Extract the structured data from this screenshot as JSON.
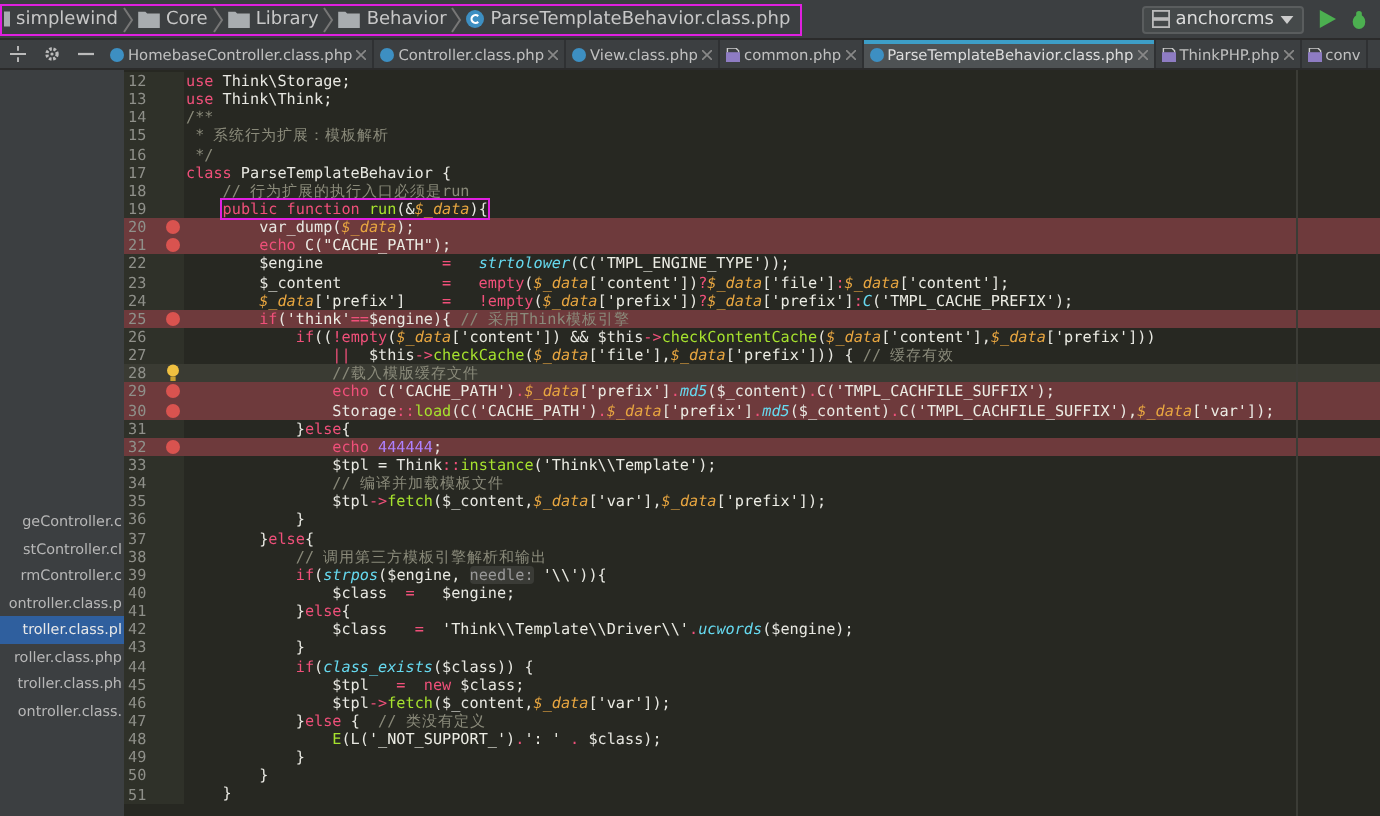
{
  "breadcrumb": {
    "annotated": true,
    "items": [
      {
        "kind": "module",
        "label": "simplewind"
      },
      {
        "kind": "folder",
        "label": "Core"
      },
      {
        "kind": "folder",
        "label": "Library"
      },
      {
        "kind": "folder",
        "label": "Behavior"
      },
      {
        "kind": "class",
        "label": "ParseTemplateBehavior.class.php"
      }
    ]
  },
  "run_config": {
    "label": "anchorcms"
  },
  "tabs": [
    {
      "label": "HomebaseController.class.php",
      "kind": "class",
      "selected": false
    },
    {
      "label": "Controller.class.php",
      "kind": "class",
      "selected": false
    },
    {
      "label": "View.class.php",
      "kind": "class",
      "selected": false
    },
    {
      "label": "common.php",
      "kind": "php",
      "selected": false
    },
    {
      "label": "ParseTemplateBehavior.class.php",
      "kind": "class",
      "selected": true
    },
    {
      "label": "ThinkPHP.php",
      "kind": "php",
      "selected": false
    },
    {
      "label": "conv",
      "kind": "php",
      "selected": false
    }
  ],
  "project_files": [
    {
      "label": "geController.c",
      "selected": false
    },
    {
      "label": "stController.cl",
      "selected": false
    },
    {
      "label": "rmController.c",
      "selected": false
    },
    {
      "label": "ontroller.class.p",
      "selected": false
    },
    {
      "label": "troller.class.pl",
      "selected": true
    },
    {
      "label": "roller.class.php",
      "selected": false
    },
    {
      "label": "troller.class.ph",
      "selected": false
    },
    {
      "label": "ontroller.class.",
      "selected": false
    }
  ],
  "lines": [
    {
      "n": "12",
      "tokens": [
        {
          "kind": "kw",
          "text": "use"
        },
        {
          "kind": "plain",
          "text": " Think\\Storage;"
        }
      ]
    },
    {
      "n": "13",
      "tokens": [
        {
          "kind": "kw",
          "text": "use"
        },
        {
          "kind": "plain",
          "text": " Think\\Think;"
        }
      ]
    },
    {
      "n": "14",
      "tokens": [
        {
          "kind": "comment",
          "text": "/**"
        }
      ]
    },
    {
      "n": "15",
      "tokens": [
        {
          "kind": "comment",
          "text": " * 系统行为扩展：模板解析"
        }
      ]
    },
    {
      "n": "16",
      "tokens": [
        {
          "kind": "comment",
          "text": " */"
        }
      ]
    },
    {
      "n": "17",
      "tokens": [
        {
          "kind": "kw",
          "text": "class"
        },
        {
          "kind": "plain",
          "text": " ParseTemplateBehavior {"
        }
      ]
    },
    {
      "n": "18",
      "tokens": [
        {
          "kind": "comment",
          "text": "    // 行为扩展的执行入口必须是run"
        }
      ]
    },
    {
      "n": "19",
      "annotated": true,
      "tokens": [
        {
          "kind": "kw",
          "text": "    public function "
        },
        {
          "kind": "fn",
          "text": "run"
        },
        {
          "kind": "plain",
          "text": "(&"
        },
        {
          "kind": "var",
          "text": "$_data"
        },
        {
          "kind": "plain",
          "text": "){"
        }
      ]
    },
    {
      "n": "20",
      "breakpoint": true,
      "tokens": [
        {
          "kind": "plain",
          "text": "        var_dump("
        },
        {
          "kind": "var",
          "text": "$_data"
        },
        {
          "kind": "plain",
          "text": ");"
        }
      ]
    },
    {
      "n": "21",
      "breakpoint": true,
      "tokens": [
        {
          "kind": "kw",
          "text": "        echo"
        },
        {
          "kind": "plain",
          "text": " C("
        },
        {
          "kind": "str",
          "text": "\"CACHE_PATH\""
        },
        {
          "kind": "plain",
          "text": ");"
        }
      ]
    },
    {
      "n": "22",
      "tokens": [
        {
          "kind": "plain",
          "text": "        $engine             "
        },
        {
          "kind": "kw",
          "text": "=   "
        },
        {
          "kind": "ifn",
          "text": "strtolower"
        },
        {
          "kind": "plain",
          "text": "(C("
        },
        {
          "kind": "str",
          "text": "'TMPL_ENGINE_TYPE'"
        },
        {
          "kind": "plain",
          "text": "));"
        }
      ]
    },
    {
      "n": "23",
      "tokens": [
        {
          "kind": "plain",
          "text": "        $_content           "
        },
        {
          "kind": "kw",
          "text": "=   empty"
        },
        {
          "kind": "plain",
          "text": "("
        },
        {
          "kind": "var",
          "text": "$_data"
        },
        {
          "kind": "plain",
          "text": "["
        },
        {
          "kind": "str",
          "text": "'content'"
        },
        {
          "kind": "plain",
          "text": "])"
        },
        {
          "kind": "kw",
          "text": "?"
        },
        {
          "kind": "var",
          "text": "$_data"
        },
        {
          "kind": "plain",
          "text": "["
        },
        {
          "kind": "str",
          "text": "'file'"
        },
        {
          "kind": "plain",
          "text": "]"
        },
        {
          "kind": "kw",
          "text": ":"
        },
        {
          "kind": "var",
          "text": "$_data"
        },
        {
          "kind": "plain",
          "text": "["
        },
        {
          "kind": "str",
          "text": "'content'"
        },
        {
          "kind": "plain",
          "text": "];"
        }
      ]
    },
    {
      "n": "24",
      "tokens": [
        {
          "kind": "var",
          "text": "        $_data"
        },
        {
          "kind": "plain",
          "text": "["
        },
        {
          "kind": "str",
          "text": "'prefix'"
        },
        {
          "kind": "plain",
          "text": "]    "
        },
        {
          "kind": "kw",
          "text": "=   !empty"
        },
        {
          "kind": "plain",
          "text": "("
        },
        {
          "kind": "var",
          "text": "$_data"
        },
        {
          "kind": "plain",
          "text": "["
        },
        {
          "kind": "str",
          "text": "'prefix'"
        },
        {
          "kind": "plain",
          "text": "])"
        },
        {
          "kind": "kw",
          "text": "?"
        },
        {
          "kind": "var",
          "text": "$_data"
        },
        {
          "kind": "plain",
          "text": "["
        },
        {
          "kind": "str",
          "text": "'prefix'"
        },
        {
          "kind": "plain",
          "text": "]"
        },
        {
          "kind": "kw",
          "text": ":"
        },
        {
          "kind": "ifn",
          "text": "C"
        },
        {
          "kind": "plain",
          "text": "("
        },
        {
          "kind": "str",
          "text": "'TMPL_CACHE_PREFIX'"
        },
        {
          "kind": "plain",
          "text": ");"
        }
      ]
    },
    {
      "n": "25",
      "breakpoint": true,
      "tokens": [
        {
          "kind": "kw",
          "text": "        if"
        },
        {
          "kind": "plain",
          "text": "("
        },
        {
          "kind": "str",
          "text": "'think'"
        },
        {
          "kind": "kw",
          "text": "=="
        },
        {
          "kind": "plain",
          "text": "$engine){ "
        },
        {
          "kind": "comment",
          "text": "// 采用Think模板引擎"
        }
      ]
    },
    {
      "n": "26",
      "tokens": [
        {
          "kind": "kw",
          "text": "            if"
        },
        {
          "kind": "plain",
          "text": "(("
        },
        {
          "kind": "kw",
          "text": "!empty"
        },
        {
          "kind": "plain",
          "text": "("
        },
        {
          "kind": "var",
          "text": "$_data"
        },
        {
          "kind": "plain",
          "text": "["
        },
        {
          "kind": "str",
          "text": "'content'"
        },
        {
          "kind": "plain",
          "text": "]) && $this"
        },
        {
          "kind": "kw",
          "text": "->"
        },
        {
          "kind": "fn",
          "text": "checkContentCache"
        },
        {
          "kind": "plain",
          "text": "("
        },
        {
          "kind": "var",
          "text": "$_data"
        },
        {
          "kind": "plain",
          "text": "["
        },
        {
          "kind": "str",
          "text": "'content'"
        },
        {
          "kind": "plain",
          "text": "],"
        },
        {
          "kind": "var",
          "text": "$_data"
        },
        {
          "kind": "plain",
          "text": "["
        },
        {
          "kind": "str",
          "text": "'prefix'"
        },
        {
          "kind": "plain",
          "text": "]))"
        }
      ]
    },
    {
      "n": "27",
      "tokens": [
        {
          "kind": "kw",
          "text": "                ||"
        },
        {
          "kind": "plain",
          "text": "  $this"
        },
        {
          "kind": "kw",
          "text": "->"
        },
        {
          "kind": "fn",
          "text": "checkCache"
        },
        {
          "kind": "plain",
          "text": "("
        },
        {
          "kind": "var",
          "text": "$_data"
        },
        {
          "kind": "plain",
          "text": "["
        },
        {
          "kind": "str",
          "text": "'file'"
        },
        {
          "kind": "plain",
          "text": "],"
        },
        {
          "kind": "var",
          "text": "$_data"
        },
        {
          "kind": "plain",
          "text": "["
        },
        {
          "kind": "str",
          "text": "'prefix'"
        },
        {
          "kind": "plain",
          "text": "])) { "
        },
        {
          "kind": "comment",
          "text": "// 缓存有效"
        }
      ]
    },
    {
      "n": "28",
      "current": true,
      "tokens": [
        {
          "kind": "comment",
          "text": "                //载入模版缓存文件"
        }
      ]
    },
    {
      "n": "29",
      "breakpoint": true,
      "tokens": [
        {
          "kind": "kw",
          "text": "                echo"
        },
        {
          "kind": "plain",
          "text": " C("
        },
        {
          "kind": "str",
          "text": "'CACHE_PATH'"
        },
        {
          "kind": "plain",
          "text": ")"
        },
        {
          "kind": "kw",
          "text": "."
        },
        {
          "kind": "var",
          "text": "$_data"
        },
        {
          "kind": "plain",
          "text": "["
        },
        {
          "kind": "str",
          "text": "'prefix'"
        },
        {
          "kind": "plain",
          "text": "]"
        },
        {
          "kind": "kw",
          "text": "."
        },
        {
          "kind": "ifn",
          "text": "md5"
        },
        {
          "kind": "plain",
          "text": "($_content)"
        },
        {
          "kind": "kw",
          "text": "."
        },
        {
          "kind": "plain",
          "text": "C("
        },
        {
          "kind": "str",
          "text": "'TMPL_CACHFILE_SUFFIX'"
        },
        {
          "kind": "plain",
          "text": ");"
        }
      ]
    },
    {
      "n": "30",
      "breakpoint": true,
      "tokens": [
        {
          "kind": "plain",
          "text": "                Storage"
        },
        {
          "kind": "kw",
          "text": "::"
        },
        {
          "kind": "fn",
          "text": "load"
        },
        {
          "kind": "plain",
          "text": "(C("
        },
        {
          "kind": "str",
          "text": "'CACHE_PATH'"
        },
        {
          "kind": "plain",
          "text": ")"
        },
        {
          "kind": "kw",
          "text": "."
        },
        {
          "kind": "var",
          "text": "$_data"
        },
        {
          "kind": "plain",
          "text": "["
        },
        {
          "kind": "str",
          "text": "'prefix'"
        },
        {
          "kind": "plain",
          "text": "]"
        },
        {
          "kind": "kw",
          "text": "."
        },
        {
          "kind": "ifn",
          "text": "md5"
        },
        {
          "kind": "plain",
          "text": "($_content)"
        },
        {
          "kind": "kw",
          "text": "."
        },
        {
          "kind": "plain",
          "text": "C("
        },
        {
          "kind": "str",
          "text": "'TMPL_CACHFILE_SUFFIX'"
        },
        {
          "kind": "plain",
          "text": "),"
        },
        {
          "kind": "var",
          "text": "$_data"
        },
        {
          "kind": "plain",
          "text": "["
        },
        {
          "kind": "str",
          "text": "'var'"
        },
        {
          "kind": "plain",
          "text": "]);"
        }
      ]
    },
    {
      "n": "31",
      "tokens": [
        {
          "kind": "plain",
          "text": "            }"
        },
        {
          "kind": "kw",
          "text": "else"
        },
        {
          "kind": "plain",
          "text": "{"
        }
      ]
    },
    {
      "n": "32",
      "breakpoint": true,
      "tokens": [
        {
          "kind": "kw",
          "text": "                echo "
        },
        {
          "kind": "num",
          "text": "444444"
        },
        {
          "kind": "plain",
          "text": ";"
        }
      ]
    },
    {
      "n": "33",
      "tokens": [
        {
          "kind": "plain",
          "text": "                $tpl = Think"
        },
        {
          "kind": "kw",
          "text": "::"
        },
        {
          "kind": "fn",
          "text": "instance"
        },
        {
          "kind": "plain",
          "text": "("
        },
        {
          "kind": "str",
          "text": "'Think\\\\Template'"
        },
        {
          "kind": "plain",
          "text": ");"
        }
      ]
    },
    {
      "n": "34",
      "tokens": [
        {
          "kind": "comment",
          "text": "                // 编译并加载模板文件"
        }
      ]
    },
    {
      "n": "35",
      "tokens": [
        {
          "kind": "plain",
          "text": "                $tpl"
        },
        {
          "kind": "kw",
          "text": "->"
        },
        {
          "kind": "fn",
          "text": "fetch"
        },
        {
          "kind": "plain",
          "text": "($_content,"
        },
        {
          "kind": "var",
          "text": "$_data"
        },
        {
          "kind": "plain",
          "text": "["
        },
        {
          "kind": "str",
          "text": "'var'"
        },
        {
          "kind": "plain",
          "text": "],"
        },
        {
          "kind": "var",
          "text": "$_data"
        },
        {
          "kind": "plain",
          "text": "["
        },
        {
          "kind": "str",
          "text": "'prefix'"
        },
        {
          "kind": "plain",
          "text": "]);"
        }
      ]
    },
    {
      "n": "36",
      "tokens": [
        {
          "kind": "plain",
          "text": "            }"
        }
      ]
    },
    {
      "n": "37",
      "tokens": [
        {
          "kind": "plain",
          "text": "        }"
        },
        {
          "kind": "kw",
          "text": "else"
        },
        {
          "kind": "plain",
          "text": "{"
        }
      ]
    },
    {
      "n": "38",
      "tokens": [
        {
          "kind": "comment",
          "text": "            // 调用第三方模板引擎解析和输出"
        }
      ]
    },
    {
      "n": "39",
      "tokens": [
        {
          "kind": "kw",
          "text": "            if"
        },
        {
          "kind": "plain",
          "text": "("
        },
        {
          "kind": "ifn",
          "text": "strpos"
        },
        {
          "kind": "plain",
          "text": "($engine, "
        },
        {
          "kind": "hint",
          "text": "needle:"
        },
        {
          "kind": "str",
          "text": " '\\\\'"
        },
        {
          "kind": "plain",
          "text": ")){"
        }
      ]
    },
    {
      "n": "40",
      "tokens": [
        {
          "kind": "plain",
          "text": "                $class  "
        },
        {
          "kind": "kw",
          "text": "="
        },
        {
          "kind": "plain",
          "text": "   $engine;"
        }
      ]
    },
    {
      "n": "41",
      "tokens": [
        {
          "kind": "plain",
          "text": "            }"
        },
        {
          "kind": "kw",
          "text": "else"
        },
        {
          "kind": "plain",
          "text": "{"
        }
      ]
    },
    {
      "n": "42",
      "tokens": [
        {
          "kind": "plain",
          "text": "                $class   "
        },
        {
          "kind": "kw",
          "text": "=  "
        },
        {
          "kind": "str",
          "text": "'Think\\\\Template\\\\Driver\\\\'"
        },
        {
          "kind": "kw",
          "text": "."
        },
        {
          "kind": "ifn",
          "text": "ucwords"
        },
        {
          "kind": "plain",
          "text": "($engine);"
        }
      ]
    },
    {
      "n": "43",
      "tokens": [
        {
          "kind": "plain",
          "text": "            }"
        }
      ]
    },
    {
      "n": "44",
      "tokens": [
        {
          "kind": "kw",
          "text": "            if"
        },
        {
          "kind": "plain",
          "text": "("
        },
        {
          "kind": "ifn",
          "text": "class_exists"
        },
        {
          "kind": "plain",
          "text": "($class)) {"
        }
      ]
    },
    {
      "n": "45",
      "tokens": [
        {
          "kind": "plain",
          "text": "                $tpl   "
        },
        {
          "kind": "kw",
          "text": "=  new"
        },
        {
          "kind": "plain",
          "text": " $class;"
        }
      ]
    },
    {
      "n": "46",
      "tokens": [
        {
          "kind": "plain",
          "text": "                $tpl"
        },
        {
          "kind": "kw",
          "text": "->"
        },
        {
          "kind": "fn",
          "text": "fetch"
        },
        {
          "kind": "plain",
          "text": "($_content,"
        },
        {
          "kind": "var",
          "text": "$_data"
        },
        {
          "kind": "plain",
          "text": "["
        },
        {
          "kind": "str",
          "text": "'var'"
        },
        {
          "kind": "plain",
          "text": "]);"
        }
      ]
    },
    {
      "n": "47",
      "tokens": [
        {
          "kind": "plain",
          "text": "            }"
        },
        {
          "kind": "kw",
          "text": "else"
        },
        {
          "kind": "plain",
          "text": " {  "
        },
        {
          "kind": "comment",
          "text": "// 类没有定义"
        }
      ]
    },
    {
      "n": "48",
      "tokens": [
        {
          "kind": "fn",
          "text": "                E"
        },
        {
          "kind": "plain",
          "text": "(L("
        },
        {
          "kind": "str",
          "text": "'_NOT_SUPPORT_'"
        },
        {
          "kind": "plain",
          "text": ")"
        },
        {
          "kind": "kw",
          "text": "."
        },
        {
          "kind": "str",
          "text": "': '"
        },
        {
          "kind": "kw",
          "text": " ."
        },
        {
          "kind": "plain",
          "text": " $class);"
        }
      ]
    },
    {
      "n": "49",
      "tokens": [
        {
          "kind": "plain",
          "text": "            }"
        }
      ]
    },
    {
      "n": "50",
      "tokens": [
        {
          "kind": "plain",
          "text": "        }"
        }
      ]
    },
    {
      "n": "51",
      "tokens": [
        {
          "kind": "plain",
          "text": "    }"
        }
      ]
    }
  ]
}
